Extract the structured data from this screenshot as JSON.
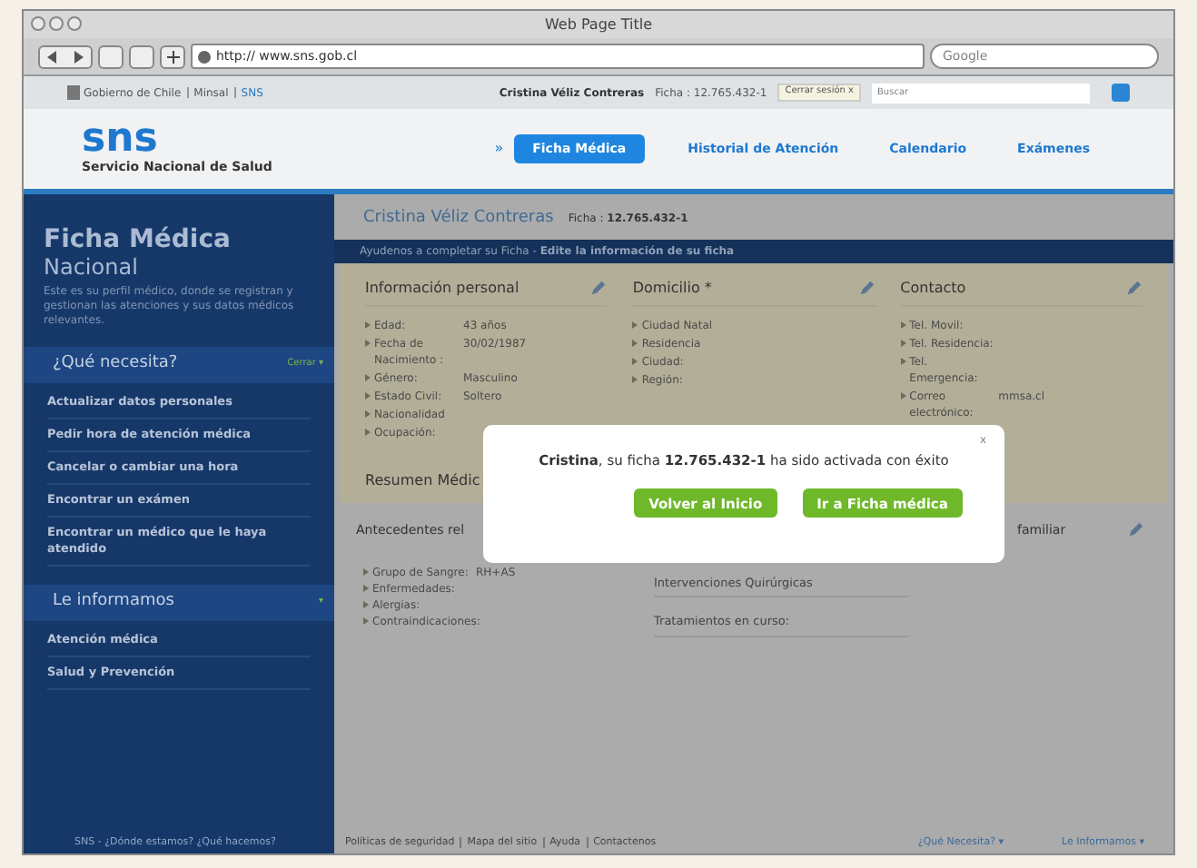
{
  "window": {
    "title": "Web Page Title"
  },
  "toolbar": {
    "url": "http:// www.sns.gob.cl",
    "search_placeholder": "Google"
  },
  "gov_bar": {
    "links": [
      "Gobierno de Chile",
      "Minsal",
      "SNS"
    ],
    "user": "Cristina Véliz Contreras",
    "ficha": "Ficha : 12.765.432-1",
    "logout": "Cerrar sesión x",
    "search_placeholder": "Buscar"
  },
  "header": {
    "logo": "sns",
    "subtitle": "Servicio Nacional de Salud",
    "nav_marker": "»",
    "tabs": [
      {
        "label": "Ficha Médica",
        "selected": true
      },
      {
        "label": "Historial de Atención",
        "selected": false
      },
      {
        "label": "Calendario",
        "selected": false
      },
      {
        "label": "Exámenes",
        "selected": false
      }
    ]
  },
  "sidebar": {
    "title": "Ficha Médica",
    "subtitle": "Nacional",
    "description": "Este es su perfil médico, donde se registran y gestionan las atenciones y sus datos médicos relevantes.",
    "sections": [
      {
        "title": "¿Qué necesita?",
        "toggle": "Cerrar ▾",
        "items": [
          "Actualizar datos personales",
          "Pedir hora de atención médica",
          "Cancelar o cambiar una hora",
          "Encontrar un exámen",
          "Encontrar un médico que le haya atendido"
        ]
      },
      {
        "title": "Le informamos",
        "toggle": "▾",
        "items": [
          "Atención médica",
          "Salud y Prevención"
        ]
      }
    ]
  },
  "content": {
    "name": "Cristina Véliz Contreras",
    "ficha": "Ficha : **12.765.432-1**",
    "banner": "Ayudenos a completar su Ficha - **Edite la información de su ficha**",
    "panels": [
      {
        "title": "Información personal",
        "rows": [
          {
            "label": "Edad:",
            "value": "43 años"
          },
          {
            "label": "Fecha de Nacimiento :",
            "value": "30/02/1987"
          },
          {
            "label": "Género:",
            "value": "Masculino"
          },
          {
            "label": "Estado Civil:",
            "value": "Soltero"
          },
          {
            "label": "Nacionalidad",
            "value": ""
          },
          {
            "label": "Ocupación:",
            "value": ""
          }
        ]
      },
      {
        "title": "Domicilio *",
        "rows": [
          {
            "label": "Ciudad Natal",
            "value": ""
          },
          {
            "label": "Residencia",
            "value": ""
          },
          {
            "label": "Ciudad:",
            "value": ""
          },
          {
            "label": "Región:",
            "value": ""
          }
        ]
      },
      {
        "title": "Contacto",
        "rows": [
          {
            "label": "Tel. Movil:",
            "value": ""
          },
          {
            "label": "Tel. Residencia:",
            "value": ""
          },
          {
            "label": "Tel. Emergencia:",
            "value": ""
          },
          {
            "label": "Correo electrónico:",
            "value": "mmsa.cl"
          }
        ]
      }
    ],
    "summary_title": "Resumen Médic",
    "antecedentes_title": "Antecedentes rel",
    "familiar_title": "familiar",
    "medical_rows": [
      {
        "label": "Grupo de Sangre:",
        "value": "RH+AS"
      },
      {
        "label": "Enfermedades:",
        "value": ""
      },
      {
        "label": "Alergias:",
        "value": ""
      },
      {
        "label": "Contraindicaciones:",
        "value": ""
      }
    ],
    "middle_rows": [
      "Intervenciones Quirúrgicas",
      "Tratamientos en curso:"
    ]
  },
  "modal": {
    "close": "x",
    "message": "**Cristina**, su ficha **12.765.432-1** ha sido activada con éxito",
    "buttons": [
      "Volver al Inicio",
      "Ir a Ficha médica"
    ]
  },
  "footer": {
    "left": "SNS - ¿Dónde estamos? ¿Qué hacemos?",
    "links": [
      "Políticas de seguridad",
      "Mapa del sitio",
      "Ayuda",
      "Contactenos"
    ],
    "right": [
      "¿Qué Necesita? ▾",
      "Le Informamos ▾"
    ]
  }
}
